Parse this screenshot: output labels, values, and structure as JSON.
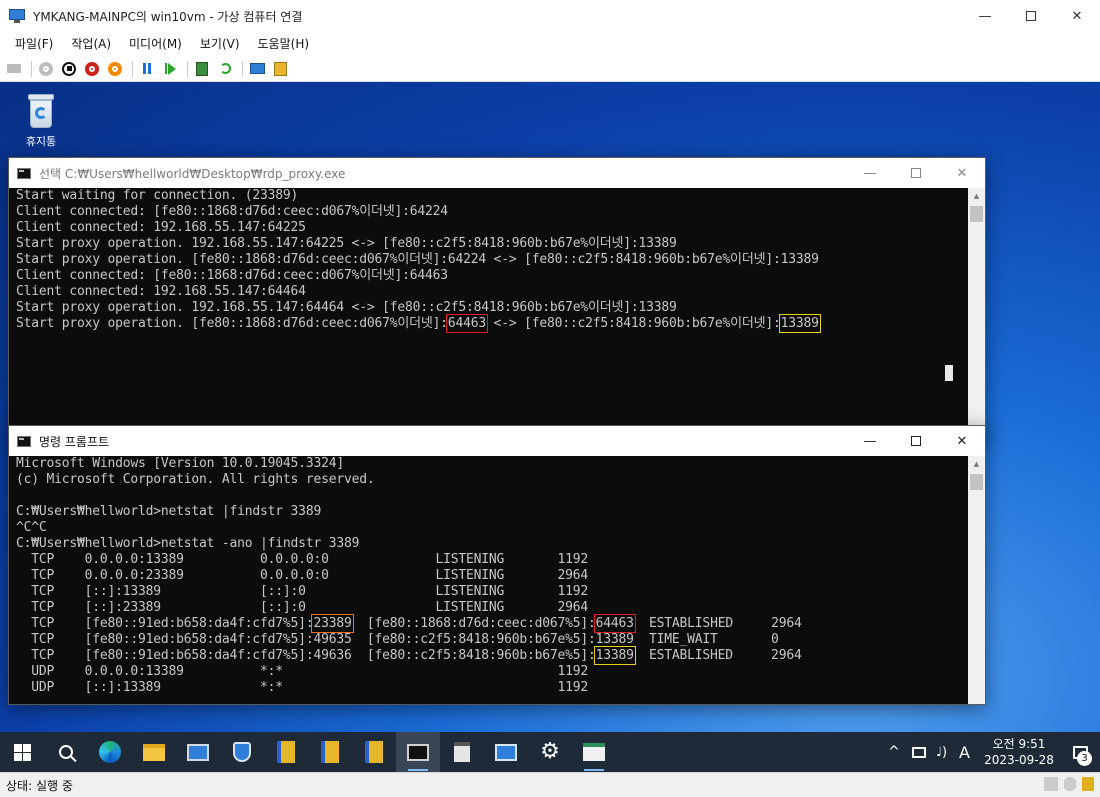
{
  "host": {
    "title": "YMKANG-MAINPC의 win10vm - 가상 컴퓨터 연결",
    "menu": [
      "파일(F)",
      "작업(A)",
      "미디어(M)",
      "보기(V)",
      "도움말(H)"
    ],
    "status": "상태: 실행 중"
  },
  "desktop": {
    "recycle_label": "휴지통"
  },
  "proxy_window": {
    "title": "선택 C:₩Users₩hellworld₩Desktop₩rdp_proxy.exe",
    "lines": [
      "Start waiting for connection. (23389)",
      "Client connected: [fe80::1868:d76d:ceec:d067%이더넷]:64224",
      "Client connected: 192.168.55.147:64225",
      "Start proxy operation. 192.168.55.147:64225 <-> [fe80::c2f5:8418:960b:b67e%이더넷]:13389",
      "Start proxy operation. [fe80::1868:d76d:ceec:d067%이더넷]:64224 <-> [fe80::c2f5:8418:960b:b67e%이더넷]:13389",
      "Client connected: [fe80::1868:d76d:ceec:d067%이더넷]:64463",
      "Client connected: 192.168.55.147:64464",
      "Start proxy operation. 192.168.55.147:64464 <-> [fe80::c2f5:8418:960b:b67e%이더넷]:13389"
    ],
    "last_line": {
      "prefix": "Start proxy operation. [fe80::1868:d76d:ceec:d067%이더넷]:",
      "port_a": "64463",
      "middle": " <-> [fe80::c2f5:8418:960b:b67e%이더넷]:",
      "port_b": "13389"
    }
  },
  "cmd_window": {
    "title": "명령 프롬프트",
    "header_lines": [
      "Microsoft Windows [Version 10.0.19045.3324]",
      "(c) Microsoft Corporation. All rights reserved.",
      "",
      "C:₩Users₩hellworld>netstat |findstr 3389",
      "^C^C",
      "C:₩Users₩hellworld>netstat -ano |findstr 3389"
    ],
    "plain_rows_top": [
      "  TCP    0.0.0.0:13389          0.0.0.0:0              LISTENING       1192",
      "  TCP    0.0.0.0:23389          0.0.0.0:0              LISTENING       2964",
      "  TCP    [::]:13389             [::]:0                 LISTENING       1192",
      "  TCP    [::]:23389             [::]:0                 LISTENING       2964"
    ],
    "row_est1": {
      "lead": "  TCP    [fe80::91ed:b658:da4f:cfd7%5]:",
      "local_port": "23389",
      "mid": "  [fe80::1868:d76d:ceec:d067%5]:",
      "remote_port": "64463",
      "tail": "  ESTABLISHED     2964"
    },
    "row_wait": "  TCP    [fe80::91ed:b658:da4f:cfd7%5]:49635  [fe80::c2f5:8418:960b:b67e%5]:13389  TIME_WAIT       0",
    "row_est2": {
      "lead": "  TCP    [fe80::91ed:b658:da4f:cfd7%5]:49636  [fe80::c2f5:8418:960b:b67e%5]:",
      "remote_port": "13389",
      "tail": "  ESTABLISHED     2964"
    },
    "plain_rows_bottom": [
      "  UDP    0.0.0.0:13389          *:*                                    1192",
      "  UDP    [::]:13389             *:*                                    1192"
    ]
  },
  "taskbar": {
    "tray_lang": "A",
    "time": "오전 9:51",
    "date": "2023-09-28",
    "notif_count": "3"
  },
  "colors": {
    "highlight_red": "#e02020",
    "highlight_yellow": "#e6d21f",
    "console_text": "#c7c7c7"
  }
}
